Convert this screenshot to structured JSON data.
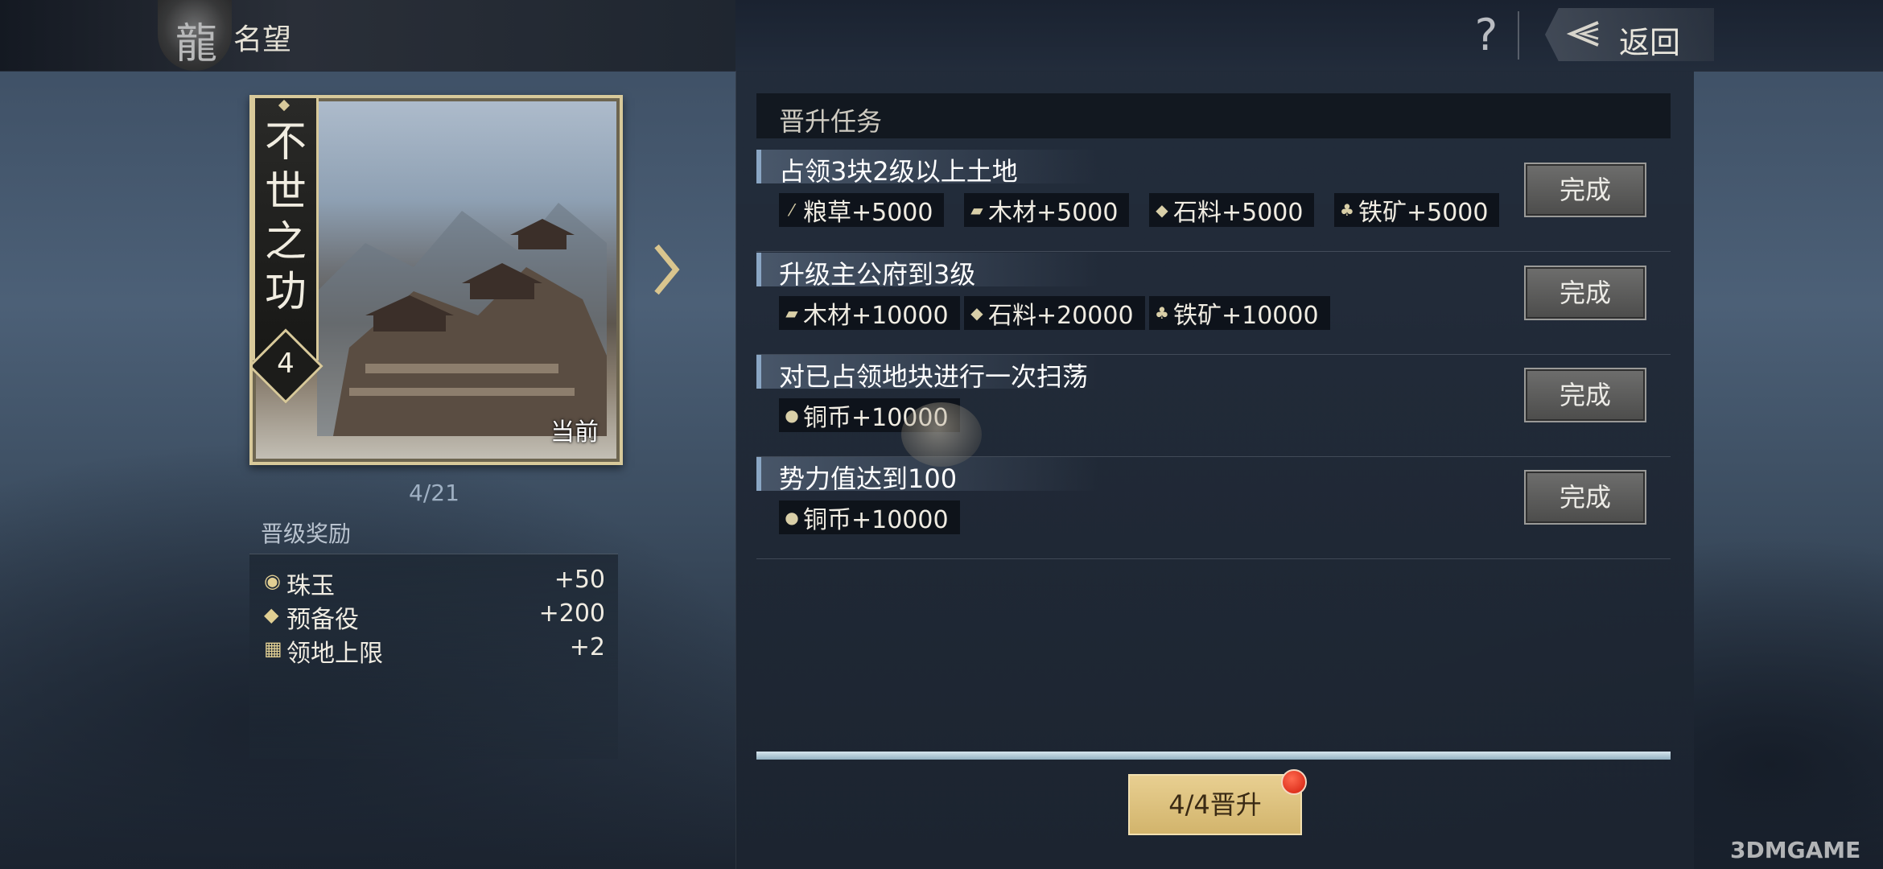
{
  "header": {
    "title": "名望",
    "help_label": "?",
    "back_label": "返回"
  },
  "card": {
    "name_chars": "不\n世\n之\n功",
    "level": "4",
    "current_label": "当前",
    "count": "4/21"
  },
  "promotion_rewards": {
    "title": "晋级奖励",
    "items": [
      {
        "icon": "jade-icon",
        "label": "珠玉",
        "value": "+50"
      },
      {
        "icon": "reserve-troops-icon",
        "label": "预备役",
        "value": "+200"
      },
      {
        "icon": "territory-icon",
        "label": "领地上限",
        "value": "+2"
      }
    ]
  },
  "tasks_panel": {
    "title": "晋升任务",
    "tasks": [
      {
        "title": "占领3块2级以上土地",
        "button": "完成",
        "rewards": [
          {
            "icon": "grain-icon",
            "text": "粮草+5000"
          },
          {
            "icon": "wood-icon",
            "text": "木材+5000"
          },
          {
            "icon": "stone-icon",
            "text": "石料+5000"
          },
          {
            "icon": "iron-icon",
            "text": "铁矿+5000"
          }
        ]
      },
      {
        "title": "升级主公府到3级",
        "button": "完成",
        "rewards": [
          {
            "icon": "wood-icon",
            "text": "木材+10000"
          },
          {
            "icon": "stone-icon",
            "text": "石料+20000"
          },
          {
            "icon": "iron-icon",
            "text": "铁矿+10000"
          }
        ]
      },
      {
        "title": "对已占领地块进行一次扫荡",
        "button": "完成",
        "rewards": [
          {
            "icon": "copper-coin-icon",
            "text": "铜币+10000"
          }
        ]
      },
      {
        "title": "势力值达到100",
        "button": "完成",
        "rewards": [
          {
            "icon": "copper-coin-icon",
            "text": "铜币+10000"
          }
        ]
      }
    ],
    "progress": 1.0,
    "promote_label": "4/4晋升"
  },
  "watermark": "3DMGAME",
  "colors": {
    "accent_gold": "#d2b46c",
    "badge_red": "#d21d0c",
    "complete_button": "#5c5c5b"
  }
}
